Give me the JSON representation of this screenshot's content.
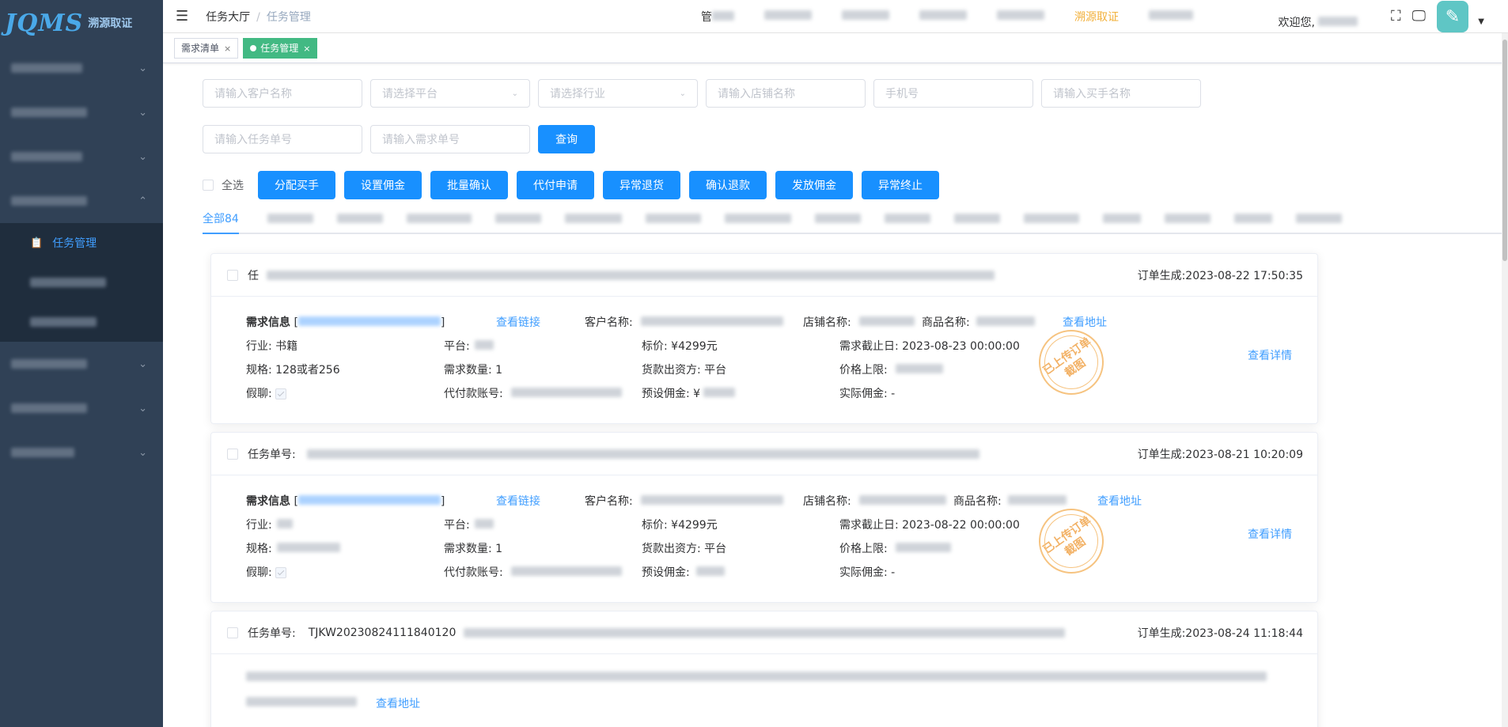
{
  "sidebar": {
    "logo_text": "JQMS",
    "logo_cn": "溯源取证",
    "active_sub": "任务管理"
  },
  "header": {
    "breadcrumb_root": "任务大厅",
    "breadcrumb_current": "任务管理",
    "topnav_partial": "管",
    "topnav_highlight": "溯源取证",
    "welcome": "欢迎您,"
  },
  "tags": [
    {
      "label": "需求清单",
      "close": "×"
    },
    {
      "label": "任务管理",
      "close": "×"
    }
  ],
  "filters": {
    "customer_name": "请输入客户名称",
    "platform": "请选择平台",
    "industry": "请选择行业",
    "shop_name": "请输入店铺名称",
    "phone": "手机号",
    "buyer_name": "请输入买手名称",
    "task_no": "请输入任务单号",
    "demand_no": "请输入需求单号",
    "query_label": "查询"
  },
  "actions": {
    "select_all": "全选",
    "buttons": [
      "分配买手",
      "设置佣金",
      "批量确认",
      "代付申请",
      "异常退货",
      "确认退款",
      "发放佣金",
      "异常终止"
    ]
  },
  "tabs": {
    "all_label": "全部84"
  },
  "cards": [
    {
      "task_label": "任",
      "created": "订单生成:2023-08-22 17:50:35",
      "demand_label": "需求信息",
      "demand_bracket_open": "[",
      "demand_bracket_close": "]",
      "view_link": "查看链接",
      "customer_label": "客户名称:",
      "shop_label": "店铺名称:",
      "product_label": "商品名称:",
      "view_address": "查看地址",
      "industry": "行业:  书籍",
      "platform": "平台:",
      "price": "标价:  ¥4299元",
      "deadline": "需求截止日:  2023-08-23 00:00:00",
      "spec": "规格:  128或者256",
      "qty": "需求数量:  1",
      "payer": "货款出资方:  平台",
      "price_cap": "价格上限:",
      "fake": "假聊:",
      "agent_account": "代付款账号:",
      "preset_comm": "预设佣金:  ¥",
      "actual_comm": "实际佣金:  -",
      "detail": "查看详情",
      "stamp": "已上传订单截图"
    },
    {
      "task_label": "任务单号:",
      "created": "订单生成:2023-08-21 10:20:09",
      "demand_label": "需求信息",
      "demand_bracket_open": "[",
      "demand_bracket_close": "]",
      "view_link": "查看链接",
      "customer_label": "客户名称:",
      "shop_label": "店铺名称:",
      "product_label": "商品名称:",
      "view_address": "查看地址",
      "industry": "行业:",
      "platform": "平台:",
      "price": "标价:  ¥4299元",
      "deadline": "需求截止日:  2023-08-22 00:00:00",
      "spec": "规格:",
      "qty": "需求数量:  1",
      "payer": "货款出资方:  平台",
      "price_cap": "价格上限:",
      "fake": "假聊:",
      "agent_account": "代付款账号:",
      "preset_comm": "预设佣金:",
      "actual_comm": "实际佣金:  -",
      "detail": "查看详情",
      "stamp": "已上传订单截图"
    },
    {
      "task_label": "任务单号:",
      "task_no": "TJKW20230824111840120",
      "created": "订单生成:2023-08-24 11:18:44",
      "view_address": "查看地址"
    }
  ],
  "colors": {
    "sidebar_bg": "#304156",
    "primary": "#1890ff",
    "tag_active": "#42b983",
    "highlight": "#f2b03a"
  }
}
